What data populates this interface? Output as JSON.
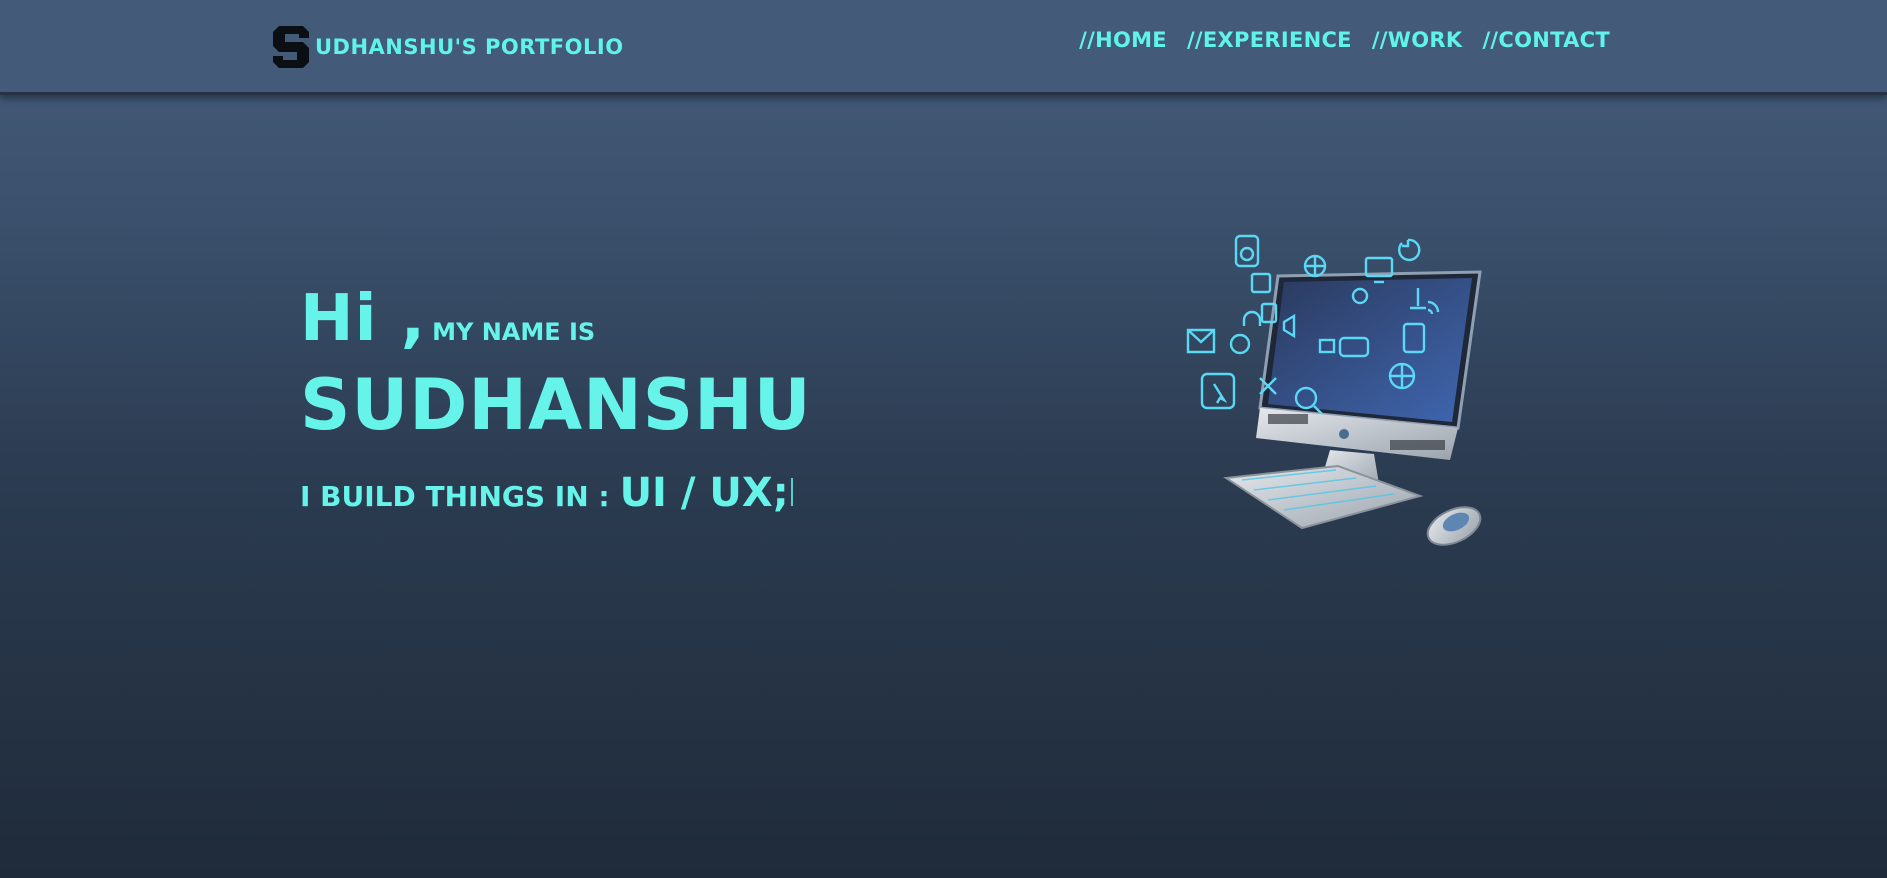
{
  "header": {
    "brand_text": "UDHANSHU'S PORTFOLIO",
    "logo_icon": "s-logo-icon",
    "nav": [
      {
        "label": "//HOME"
      },
      {
        "label": "//EXPERIENCE"
      },
      {
        "label": "//WORK"
      },
      {
        "label": "//CONTACT"
      }
    ]
  },
  "hero": {
    "greeting_big": "Hi ,",
    "greeting_small": "my name is",
    "name": "SUDHANSHU",
    "tagline_lead": "I build things in :",
    "tagline_skill": "UI / UX;",
    "illustration_icon": "computer-with-app-icons"
  },
  "colors": {
    "accent": "#5ff3ea",
    "nav_bg": "#435b79",
    "bg_top": "#465d7b",
    "bg_bottom": "#1f2b3a"
  }
}
